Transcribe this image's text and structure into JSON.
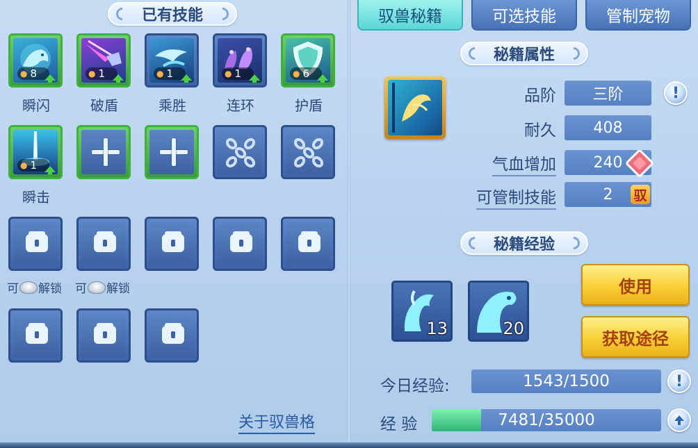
{
  "left_panel": {
    "title": "已有技能",
    "skills": [
      {
        "name": "瞬闪",
        "level": "8",
        "upgradable": true,
        "icon": "wolf-dash-icon"
      },
      {
        "name": "破盾",
        "level": "1",
        "upgradable": true,
        "icon": "claw-break-icon"
      },
      {
        "name": "乘胜",
        "level": "1",
        "upgradable": true,
        "icon": "pursuit-icon"
      },
      {
        "name": "连环",
        "level": "1",
        "upgradable": true,
        "icon": "twin-claw-icon"
      },
      {
        "name": "护盾",
        "level": "6",
        "upgradable": true,
        "icon": "shield-icon"
      },
      {
        "name": "瞬击",
        "level": "1",
        "upgradable": true,
        "icon": "sword-strike-icon"
      }
    ],
    "unlock_text_prefix": "可",
    "unlock_text_suffix": "解锁",
    "about_link": "关于驭兽格"
  },
  "tabs": [
    {
      "label": "驭兽秘籍",
      "active": true
    },
    {
      "label": "可选技能",
      "active": false
    },
    {
      "label": "管制宠物",
      "active": false
    }
  ],
  "book_props": {
    "title": "秘籍属性",
    "rows": [
      {
        "label": "品阶",
        "value": "三阶"
      },
      {
        "label": "耐久",
        "value": "408"
      },
      {
        "label": "气血增加",
        "value": "240"
      },
      {
        "label": "可管制技能",
        "value": "2"
      }
    ],
    "control_badge": "驭",
    "info_glyph": "!"
  },
  "book_exp": {
    "title": "秘籍经验",
    "items": [
      {
        "count": "13",
        "icon": "spirit-horse-small-icon"
      },
      {
        "count": "20",
        "icon": "spirit-horse-large-icon"
      }
    ],
    "use_button": "使用",
    "source_button": "获取途径",
    "today_label": "今日经验:",
    "today_value": "1543/1500",
    "exp_label": "经 验",
    "exp_value": "7481/35000",
    "exp_progress": 0.214
  },
  "colors": {
    "active_tab": "#5bd6d6",
    "gold_button": "#f8cf36",
    "slot_green": "#3fb13f",
    "exp_fill": "#2fb37a"
  }
}
